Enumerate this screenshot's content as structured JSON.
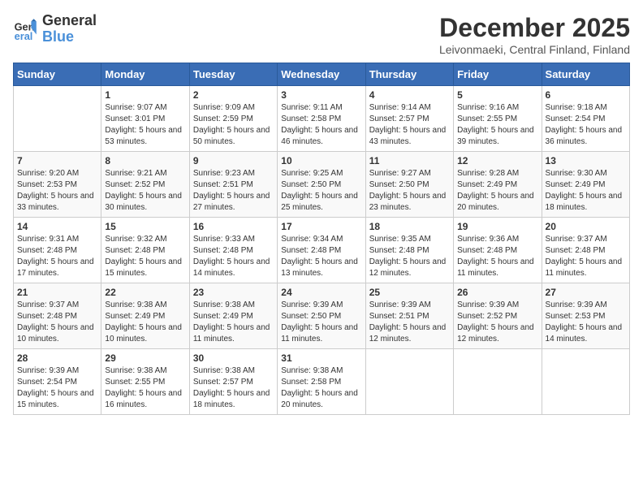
{
  "header": {
    "logo_general": "General",
    "logo_blue": "Blue",
    "month": "December 2025",
    "location": "Leivonmaeki, Central Finland, Finland"
  },
  "days_of_week": [
    "Sunday",
    "Monday",
    "Tuesday",
    "Wednesday",
    "Thursday",
    "Friday",
    "Saturday"
  ],
  "weeks": [
    [
      {
        "day": "",
        "sunrise": "",
        "sunset": "",
        "daylight": ""
      },
      {
        "day": "1",
        "sunrise": "Sunrise: 9:07 AM",
        "sunset": "Sunset: 3:01 PM",
        "daylight": "Daylight: 5 hours and 53 minutes."
      },
      {
        "day": "2",
        "sunrise": "Sunrise: 9:09 AM",
        "sunset": "Sunset: 2:59 PM",
        "daylight": "Daylight: 5 hours and 50 minutes."
      },
      {
        "day": "3",
        "sunrise": "Sunrise: 9:11 AM",
        "sunset": "Sunset: 2:58 PM",
        "daylight": "Daylight: 5 hours and 46 minutes."
      },
      {
        "day": "4",
        "sunrise": "Sunrise: 9:14 AM",
        "sunset": "Sunset: 2:57 PM",
        "daylight": "Daylight: 5 hours and 43 minutes."
      },
      {
        "day": "5",
        "sunrise": "Sunrise: 9:16 AM",
        "sunset": "Sunset: 2:55 PM",
        "daylight": "Daylight: 5 hours and 39 minutes."
      },
      {
        "day": "6",
        "sunrise": "Sunrise: 9:18 AM",
        "sunset": "Sunset: 2:54 PM",
        "daylight": "Daylight: 5 hours and 36 minutes."
      }
    ],
    [
      {
        "day": "7",
        "sunrise": "Sunrise: 9:20 AM",
        "sunset": "Sunset: 2:53 PM",
        "daylight": "Daylight: 5 hours and 33 minutes."
      },
      {
        "day": "8",
        "sunrise": "Sunrise: 9:21 AM",
        "sunset": "Sunset: 2:52 PM",
        "daylight": "Daylight: 5 hours and 30 minutes."
      },
      {
        "day": "9",
        "sunrise": "Sunrise: 9:23 AM",
        "sunset": "Sunset: 2:51 PM",
        "daylight": "Daylight: 5 hours and 27 minutes."
      },
      {
        "day": "10",
        "sunrise": "Sunrise: 9:25 AM",
        "sunset": "Sunset: 2:50 PM",
        "daylight": "Daylight: 5 hours and 25 minutes."
      },
      {
        "day": "11",
        "sunrise": "Sunrise: 9:27 AM",
        "sunset": "Sunset: 2:50 PM",
        "daylight": "Daylight: 5 hours and 23 minutes."
      },
      {
        "day": "12",
        "sunrise": "Sunrise: 9:28 AM",
        "sunset": "Sunset: 2:49 PM",
        "daylight": "Daylight: 5 hours and 20 minutes."
      },
      {
        "day": "13",
        "sunrise": "Sunrise: 9:30 AM",
        "sunset": "Sunset: 2:49 PM",
        "daylight": "Daylight: 5 hours and 18 minutes."
      }
    ],
    [
      {
        "day": "14",
        "sunrise": "Sunrise: 9:31 AM",
        "sunset": "Sunset: 2:48 PM",
        "daylight": "Daylight: 5 hours and 17 minutes."
      },
      {
        "day": "15",
        "sunrise": "Sunrise: 9:32 AM",
        "sunset": "Sunset: 2:48 PM",
        "daylight": "Daylight: 5 hours and 15 minutes."
      },
      {
        "day": "16",
        "sunrise": "Sunrise: 9:33 AM",
        "sunset": "Sunset: 2:48 PM",
        "daylight": "Daylight: 5 hours and 14 minutes."
      },
      {
        "day": "17",
        "sunrise": "Sunrise: 9:34 AM",
        "sunset": "Sunset: 2:48 PM",
        "daylight": "Daylight: 5 hours and 13 minutes."
      },
      {
        "day": "18",
        "sunrise": "Sunrise: 9:35 AM",
        "sunset": "Sunset: 2:48 PM",
        "daylight": "Daylight: 5 hours and 12 minutes."
      },
      {
        "day": "19",
        "sunrise": "Sunrise: 9:36 AM",
        "sunset": "Sunset: 2:48 PM",
        "daylight": "Daylight: 5 hours and 11 minutes."
      },
      {
        "day": "20",
        "sunrise": "Sunrise: 9:37 AM",
        "sunset": "Sunset: 2:48 PM",
        "daylight": "Daylight: 5 hours and 11 minutes."
      }
    ],
    [
      {
        "day": "21",
        "sunrise": "Sunrise: 9:37 AM",
        "sunset": "Sunset: 2:48 PM",
        "daylight": "Daylight: 5 hours and 10 minutes."
      },
      {
        "day": "22",
        "sunrise": "Sunrise: 9:38 AM",
        "sunset": "Sunset: 2:49 PM",
        "daylight": "Daylight: 5 hours and 10 minutes."
      },
      {
        "day": "23",
        "sunrise": "Sunrise: 9:38 AM",
        "sunset": "Sunset: 2:49 PM",
        "daylight": "Daylight: 5 hours and 11 minutes."
      },
      {
        "day": "24",
        "sunrise": "Sunrise: 9:39 AM",
        "sunset": "Sunset: 2:50 PM",
        "daylight": "Daylight: 5 hours and 11 minutes."
      },
      {
        "day": "25",
        "sunrise": "Sunrise: 9:39 AM",
        "sunset": "Sunset: 2:51 PM",
        "daylight": "Daylight: 5 hours and 12 minutes."
      },
      {
        "day": "26",
        "sunrise": "Sunrise: 9:39 AM",
        "sunset": "Sunset: 2:52 PM",
        "daylight": "Daylight: 5 hours and 12 minutes."
      },
      {
        "day": "27",
        "sunrise": "Sunrise: 9:39 AM",
        "sunset": "Sunset: 2:53 PM",
        "daylight": "Daylight: 5 hours and 14 minutes."
      }
    ],
    [
      {
        "day": "28",
        "sunrise": "Sunrise: 9:39 AM",
        "sunset": "Sunset: 2:54 PM",
        "daylight": "Daylight: 5 hours and 15 minutes."
      },
      {
        "day": "29",
        "sunrise": "Sunrise: 9:38 AM",
        "sunset": "Sunset: 2:55 PM",
        "daylight": "Daylight: 5 hours and 16 minutes."
      },
      {
        "day": "30",
        "sunrise": "Sunrise: 9:38 AM",
        "sunset": "Sunset: 2:57 PM",
        "daylight": "Daylight: 5 hours and 18 minutes."
      },
      {
        "day": "31",
        "sunrise": "Sunrise: 9:38 AM",
        "sunset": "Sunset: 2:58 PM",
        "daylight": "Daylight: 5 hours and 20 minutes."
      },
      {
        "day": "",
        "sunrise": "",
        "sunset": "",
        "daylight": ""
      },
      {
        "day": "",
        "sunrise": "",
        "sunset": "",
        "daylight": ""
      },
      {
        "day": "",
        "sunrise": "",
        "sunset": "",
        "daylight": ""
      }
    ]
  ]
}
